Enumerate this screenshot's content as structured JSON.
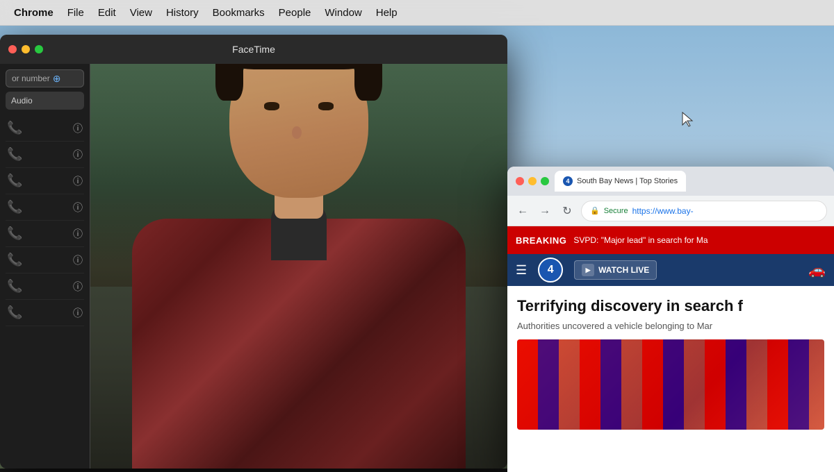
{
  "menubar": {
    "items": [
      {
        "label": "Chrome",
        "bold": true
      },
      {
        "label": "File"
      },
      {
        "label": "Edit"
      },
      {
        "label": "View"
      },
      {
        "label": "History"
      },
      {
        "label": "Bookmarks"
      },
      {
        "label": "People"
      },
      {
        "label": "Window"
      },
      {
        "label": "Help"
      }
    ]
  },
  "facetime": {
    "title": "FaceTime",
    "sidebar": {
      "search_placeholder": "or number",
      "audio_label": "Audio",
      "contacts": [
        {
          "phone": "📞",
          "info": "ⓘ"
        },
        {
          "phone": "📞",
          "info": "ⓘ"
        },
        {
          "phone": "📞",
          "info": "ⓘ"
        },
        {
          "phone": "📞",
          "info": "ⓘ"
        },
        {
          "phone": "📞",
          "info": "ⓘ"
        },
        {
          "phone": "📞",
          "info": "ⓘ"
        },
        {
          "phone": "📞",
          "info": "ⓘ"
        },
        {
          "phone": "📞",
          "info": "ⓘ"
        }
      ]
    }
  },
  "chrome": {
    "tab_title": "South Bay News | Top Stories",
    "tab_favicon": "4",
    "nav": {
      "back": "←",
      "forward": "→",
      "reload": "↻"
    },
    "address": {
      "secure_label": "Secure",
      "url": "https://www.bay-"
    },
    "breaking": {
      "label": "BREAKING",
      "text": "SVPD: \"Major lead\" in search for Ma"
    },
    "news_logo": "4",
    "watch_live": "WATCH LIVE",
    "headline": "Terrifying discovery in search f",
    "subtext": "Authorities uncovered a vehicle belonging to Mar"
  }
}
